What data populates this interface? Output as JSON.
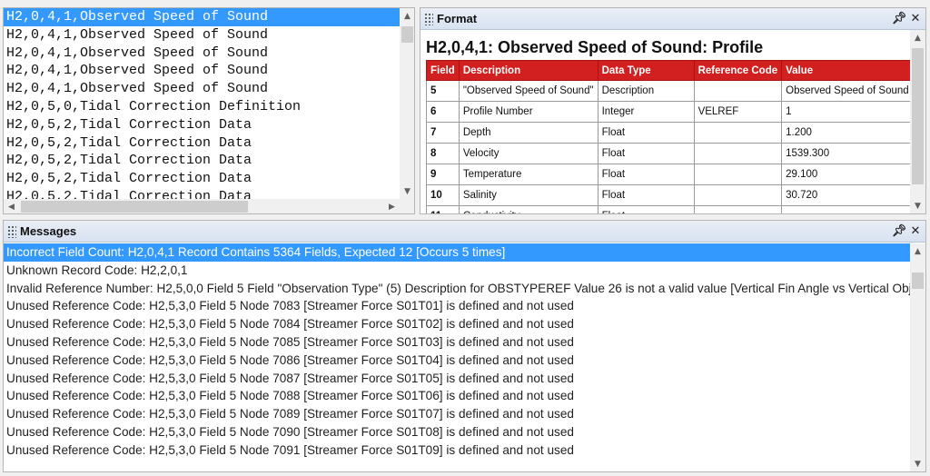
{
  "records": {
    "lines": [
      "H2,0,4,1,Observed Speed of Sound",
      "H2,0,4,1,Observed Speed of Sound",
      "H2,0,4,1,Observed Speed of Sound",
      "H2,0,4,1,Observed Speed of Sound",
      "H2,0,4,1,Observed Speed of Sound",
      "H2,0,5,0,Tidal Correction Definition",
      "H2,0,5,2,Tidal Correction Data",
      "H2,0,5,2,Tidal Correction Data",
      "H2,0,5,2,Tidal Correction Data",
      "H2,0,5,2,Tidal Correction Data",
      "H2,0,5,2,Tidal Correction Data"
    ],
    "selected_index": 0
  },
  "format": {
    "header": "Format",
    "title": "H2,0,4,1: Observed Speed of Sound: Profile",
    "columns": [
      "Field",
      "Description",
      "Data Type",
      "Reference Code",
      "Value"
    ],
    "rows": [
      {
        "field": "5",
        "description": "\"Observed Speed of Sound\"",
        "data_type": "Description",
        "reference_code": "",
        "value": "Observed Speed of Sound"
      },
      {
        "field": "6",
        "description": "Profile Number",
        "data_type": "Integer",
        "reference_code": "VELREF",
        "value": "1"
      },
      {
        "field": "7",
        "description": "Depth",
        "data_type": "Float",
        "reference_code": "",
        "value": "1.200"
      },
      {
        "field": "8",
        "description": "Velocity",
        "data_type": "Float",
        "reference_code": "",
        "value": "1539.300"
      },
      {
        "field": "9",
        "description": "Temperature",
        "data_type": "Float",
        "reference_code": "",
        "value": "29.100"
      },
      {
        "field": "10",
        "description": "Salinity",
        "data_type": "Float",
        "reference_code": "",
        "value": "30.720"
      },
      {
        "field": "11",
        "description": "Conductivity",
        "data_type": "Float",
        "reference_code": "",
        "value": ""
      }
    ]
  },
  "messages": {
    "header": "Messages",
    "lines": [
      "Incorrect Field Count: H2,0,4,1 Record Contains 5364 Fields, Expected 12 [Occurs 5 times]",
      "Unknown Record Code: H2,2,0,1",
      "Invalid Reference Number: H2,5,0,0 Field 5 Field \"Observation Type\" (5) Description for OBSTYPEREF Value 26 is not a valid value [Vertical Fin Angle vs Vertical Object",
      "Unused Reference Code: H2,5,3,0 Field 5 Node 7083 [Streamer Force S01T01] is defined and not used",
      "Unused Reference Code: H2,5,3,0 Field 5 Node 7084 [Streamer Force S01T02] is defined and not used",
      "Unused Reference Code: H2,5,3,0 Field 5 Node 7085 [Streamer Force S01T03] is defined and not used",
      "Unused Reference Code: H2,5,3,0 Field 5 Node 7086 [Streamer Force S01T04] is defined and not used",
      "Unused Reference Code: H2,5,3,0 Field 5 Node 7087 [Streamer Force S01T05] is defined and not used",
      "Unused Reference Code: H2,5,3,0 Field 5 Node 7088 [Streamer Force S01T06] is defined and not used",
      "Unused Reference Code: H2,5,3,0 Field 5 Node 7089 [Streamer Force S01T07] is defined and not used",
      "Unused Reference Code: H2,5,3,0 Field 5 Node 7090 [Streamer Force S01T08] is defined and not used",
      "Unused Reference Code: H2,5,3,0 Field 5 Node 7091 [Streamer Force S01T09] is defined and not used"
    ],
    "selected_index": 0
  },
  "icons": {
    "pin": "pin-icon",
    "close": "close-icon",
    "grip": "grip-icon",
    "scroll_up": "chevron-up-icon",
    "scroll_down": "chevron-down-icon",
    "scroll_left": "chevron-left-icon",
    "scroll_right": "chevron-right-icon"
  },
  "colors": {
    "selection": "#3399ff",
    "table_header": "#d21f1f",
    "pane_header": "#d7e2f1"
  }
}
